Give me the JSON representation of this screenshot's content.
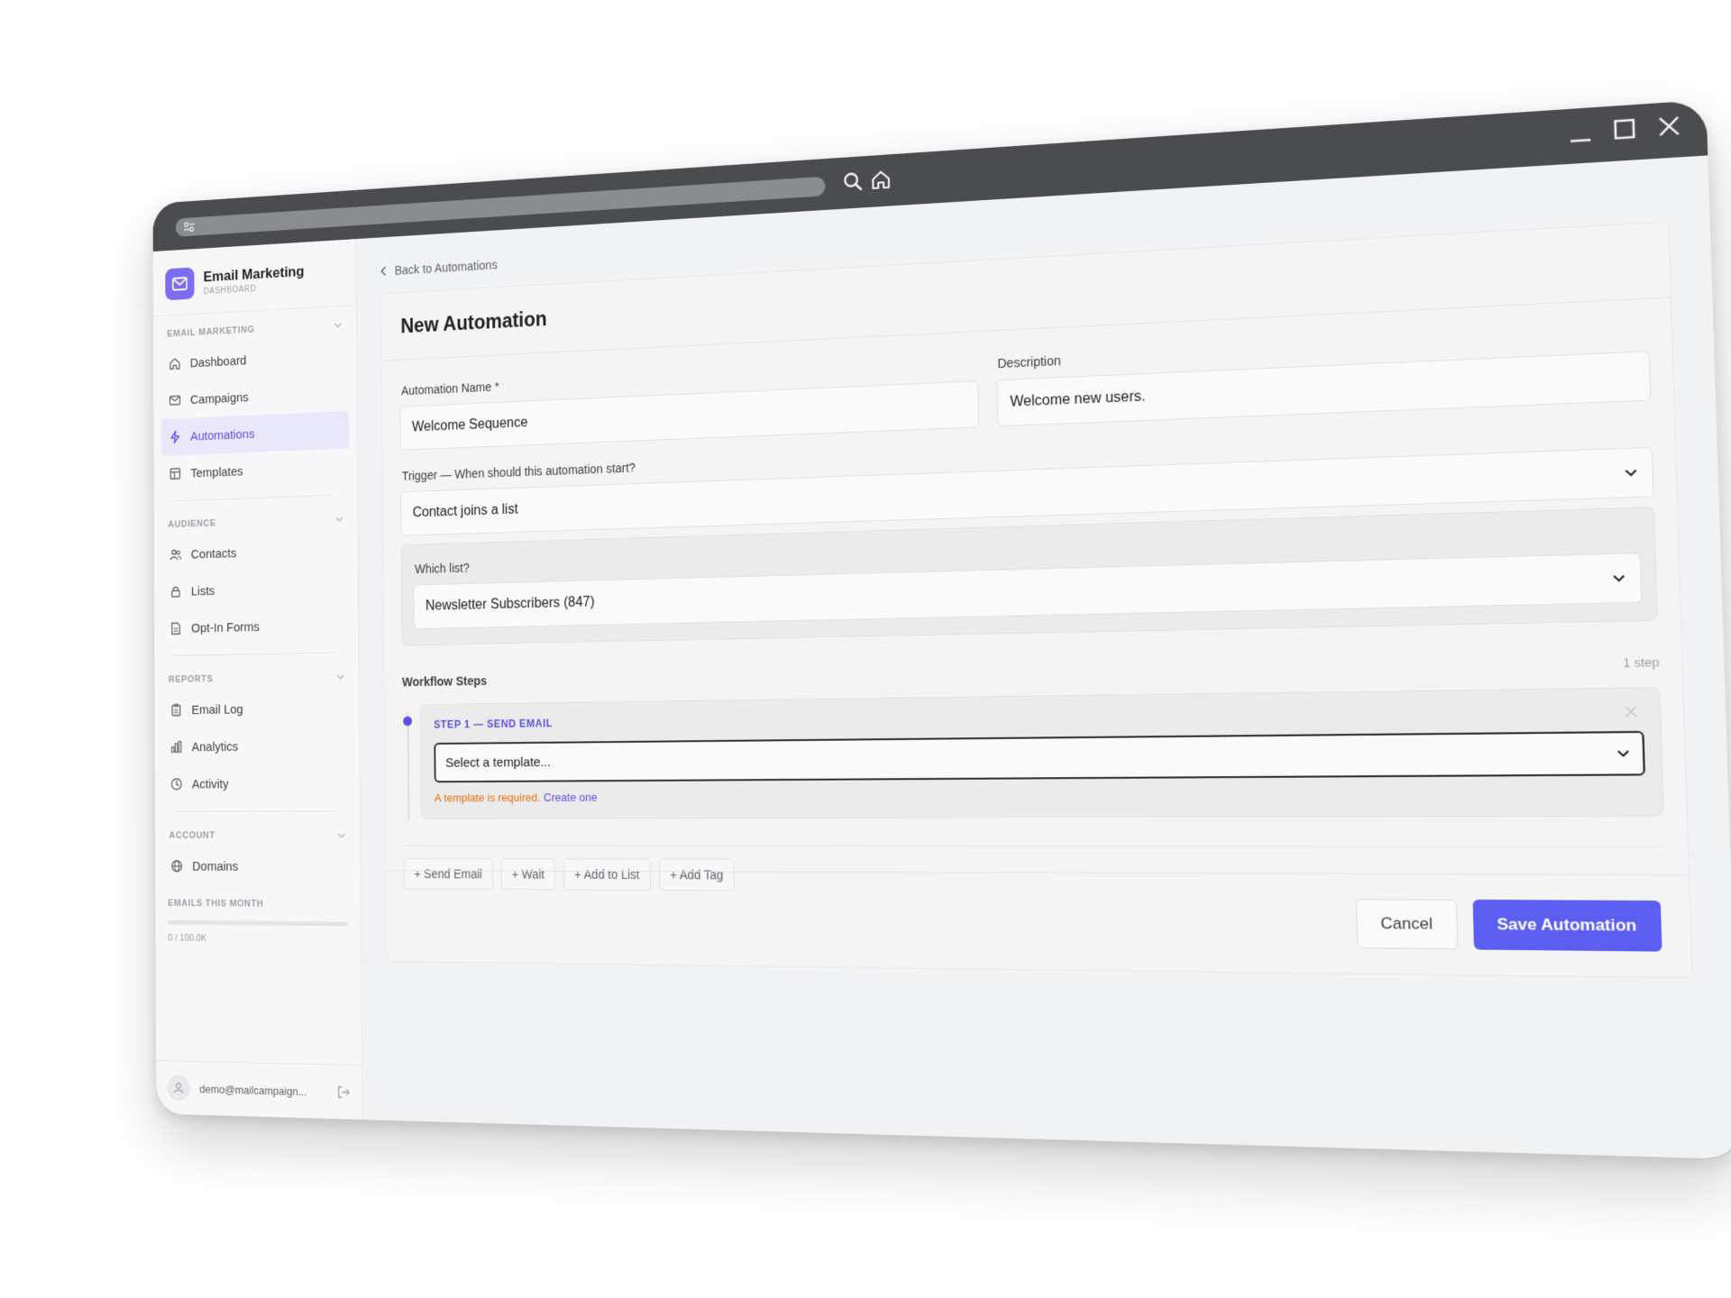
{
  "app": {
    "name": "Email Marketing",
    "subtitle": "DASHBOARD",
    "accent": "#5b4fe0"
  },
  "sidebar": {
    "sections": [
      {
        "title": "EMAIL MARKETING",
        "items": [
          {
            "label": "Dashboard",
            "icon": "home-icon"
          },
          {
            "label": "Campaigns",
            "icon": "mail-icon"
          },
          {
            "label": "Automations",
            "icon": "bolt-icon",
            "active": true
          },
          {
            "label": "Templates",
            "icon": "template-icon"
          }
        ]
      },
      {
        "title": "AUDIENCE",
        "items": [
          {
            "label": "Contacts",
            "icon": "users-icon"
          },
          {
            "label": "Lists",
            "icon": "lock-icon"
          },
          {
            "label": "Opt-In Forms",
            "icon": "file-icon"
          }
        ]
      },
      {
        "title": "REPORTS",
        "items": [
          {
            "label": "Email Log",
            "icon": "clipboard-icon"
          },
          {
            "label": "Analytics",
            "icon": "bar-chart-icon"
          },
          {
            "label": "Activity",
            "icon": "clock-icon"
          }
        ]
      },
      {
        "title": "ACCOUNT",
        "items": [
          {
            "label": "Domains",
            "icon": "globe-icon"
          }
        ]
      }
    ],
    "usage": {
      "label": "EMAILS THIS MONTH",
      "count": "0 / 100.0K",
      "fraction": 0.0
    },
    "user": {
      "email": "demo@mailcampaign..."
    }
  },
  "main": {
    "back_label": "Back to Automations",
    "title": "New Automation",
    "form": {
      "name_label": "Automation Name *",
      "name_value": "Welcome Sequence",
      "description_label": "Description",
      "description_value": "Welcome new users.",
      "trigger_label": "Trigger — When should this automation start?",
      "trigger_value": "Contact joins a list",
      "list_label": "Which list?",
      "list_value": "Newsletter Subscribers (847)"
    },
    "workflow": {
      "title": "Workflow Steps",
      "count": "1 step",
      "steps": [
        {
          "label": "STEP 1 — SEND EMAIL",
          "template_placeholder": "Select a template...",
          "error": "A template is required.",
          "error_link": "Create one"
        }
      ],
      "add_buttons": [
        "+ Send Email",
        "+ Wait",
        "+ Add to List",
        "+ Add Tag"
      ]
    },
    "actions": {
      "cancel": "Cancel",
      "save": "Save Automation"
    }
  }
}
